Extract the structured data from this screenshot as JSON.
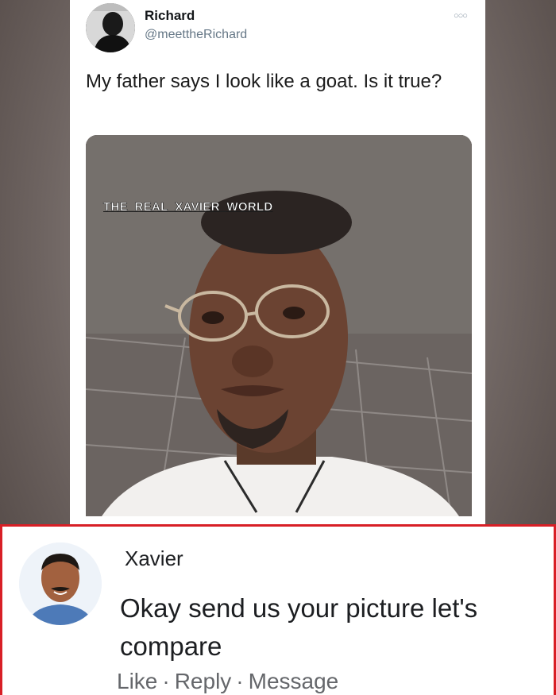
{
  "tweet": {
    "display_name": "Richard",
    "handle": "@meettheRichard",
    "more_icon": "more-options-icon",
    "text": "My father says I look like a goat. Is it true?",
    "image_watermark": "THE_REAL_XAVIER_WORLD"
  },
  "comment": {
    "author": "Xavier",
    "text": "Okay send us your picture let's compare",
    "actions": {
      "like": "Like",
      "reply": "Reply",
      "message": "Message",
      "separator": "·"
    }
  },
  "colors": {
    "comment_border": "#d81f26",
    "handle": "#657786",
    "action_text": "#65676b"
  }
}
